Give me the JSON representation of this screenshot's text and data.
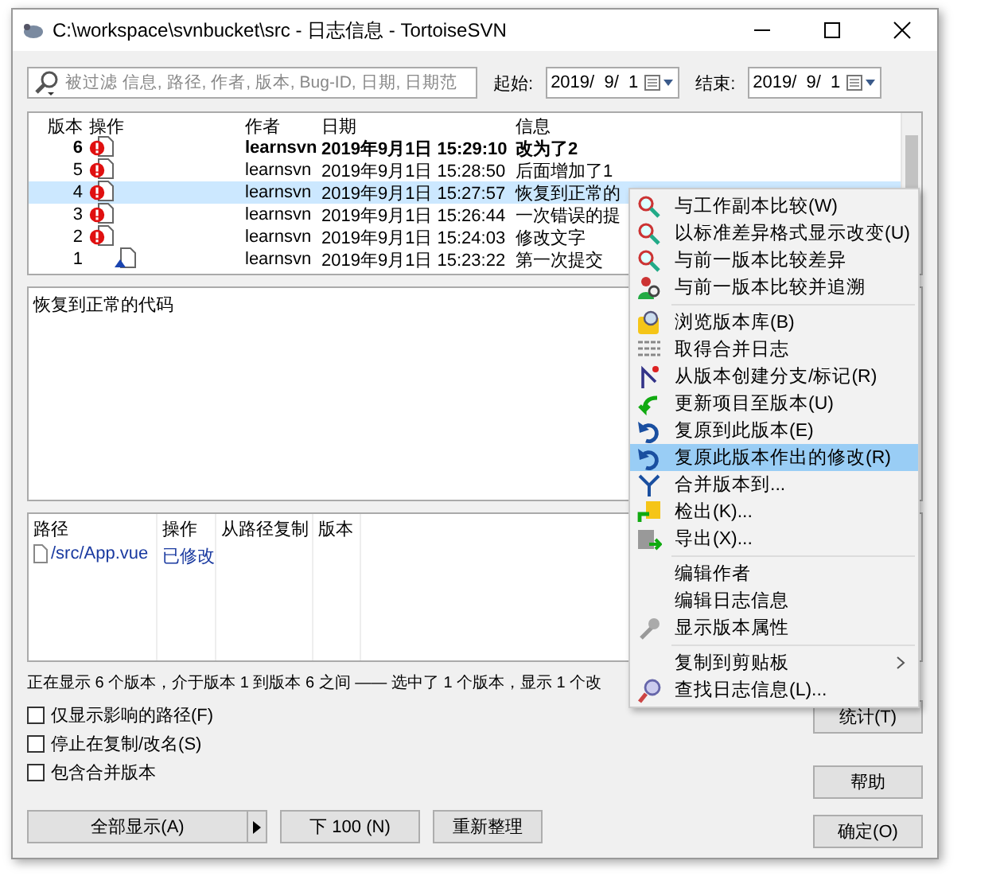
{
  "window": {
    "title": "C:\\workspace\\svnbucket\\src - 日志信息 - TortoiseSVN"
  },
  "filter": {
    "placeholder": "被过滤 信息, 路径, 作者, 版本, Bug-ID, 日期, 日期范",
    "from": {
      "label": "起始:",
      "value": "2019/  9/  1"
    },
    "to": {
      "label": "结束:",
      "value": "2019/  9/  1"
    }
  },
  "revisions": {
    "columns": [
      "版本",
      "操作",
      "作者",
      "日期",
      "信息"
    ],
    "rows": [
      {
        "revision": "6",
        "kind": "modified",
        "author": "learnsvn",
        "date": "2019年9月1日 15:29:10",
        "message": "改为了2",
        "bold": true,
        "selected": false
      },
      {
        "revision": "5",
        "kind": "modified",
        "author": "learnsvn",
        "date": "2019年9月1日 15:28:50",
        "message": "后面增加了1",
        "bold": false,
        "selected": false
      },
      {
        "revision": "4",
        "kind": "modified",
        "author": "learnsvn",
        "date": "2019年9月1日 15:27:57",
        "message": "恢复到正常的",
        "bold": false,
        "selected": true
      },
      {
        "revision": "3",
        "kind": "modified",
        "author": "learnsvn",
        "date": "2019年9月1日 15:26:44",
        "message": "一次错误的提",
        "bold": false,
        "selected": false
      },
      {
        "revision": "2",
        "kind": "modified",
        "author": "learnsvn",
        "date": "2019年9月1日 15:24:03",
        "message": "修改文字",
        "bold": false,
        "selected": false
      },
      {
        "revision": "1",
        "kind": "added",
        "author": "learnsvn",
        "date": "2019年9月1日 15:23:22",
        "message": "第一次提交",
        "bold": false,
        "selected": false
      }
    ]
  },
  "message": "恢复到正常的代码",
  "paths": {
    "columns": [
      "路径",
      "操作",
      "从路径复制",
      "版本"
    ],
    "rows": [
      {
        "path": "/src/App.vue",
        "action": "已修改"
      }
    ]
  },
  "status": "正在显示 6 个版本，介于版本 1 到版本 6 之间 —— 选中了 1 个版本，显示 1 个改",
  "options": [
    {
      "label": "仅显示影响的路径(F)",
      "checked": false
    },
    {
      "label": "停止在复制/改名(S)",
      "checked": false
    },
    {
      "label": "包含合并版本",
      "checked": false
    }
  ],
  "buttons": {
    "show_all": "全部显示(A)",
    "next": "下 100 (N)",
    "refresh": "重新整理",
    "statistics": "统计(T)",
    "help": "帮助",
    "ok": "确定(O)"
  },
  "context_menu": {
    "items": [
      {
        "kind": "compare",
        "label": "与工作副本比较(W)",
        "highlighted": false
      },
      {
        "kind": "compare",
        "label": "以标准差异格式显示改变(U)",
        "highlighted": false
      },
      {
        "kind": "compare",
        "label": "与前一版本比较差异",
        "highlighted": false
      },
      {
        "kind": "blame",
        "label": "与前一版本比较并追溯",
        "highlighted": false
      },
      {
        "kind": "separator"
      },
      {
        "kind": "browse",
        "label": "浏览版本库(B)",
        "highlighted": false
      },
      {
        "kind": "mergelog",
        "label": "取得合并日志",
        "highlighted": false
      },
      {
        "kind": "branch",
        "label": "从版本创建分支/标记(R)",
        "highlighted": false
      },
      {
        "kind": "update",
        "label": "更新项目至版本(U)",
        "highlighted": false
      },
      {
        "kind": "revert",
        "label": "复原到此版本(E)",
        "highlighted": false
      },
      {
        "kind": "revert",
        "label": "复原此版本作出的修改(R)",
        "highlighted": true
      },
      {
        "kind": "merge",
        "label": "合并版本到...",
        "highlighted": false
      },
      {
        "kind": "checkout",
        "label": "检出(K)...",
        "highlighted": false
      },
      {
        "kind": "export",
        "label": "导出(X)...",
        "highlighted": false
      },
      {
        "kind": "separator"
      },
      {
        "kind": "plain",
        "label": "编辑作者",
        "highlighted": false
      },
      {
        "kind": "plain",
        "label": "编辑日志信息",
        "highlighted": false
      },
      {
        "kind": "properties",
        "label": "显示版本属性",
        "highlighted": false
      },
      {
        "kind": "separator"
      },
      {
        "kind": "plain",
        "label": "复制到剪贴板",
        "highlighted": false,
        "submenu": true
      },
      {
        "kind": "find",
        "label": "查找日志信息(L)...",
        "highlighted": false
      }
    ]
  }
}
